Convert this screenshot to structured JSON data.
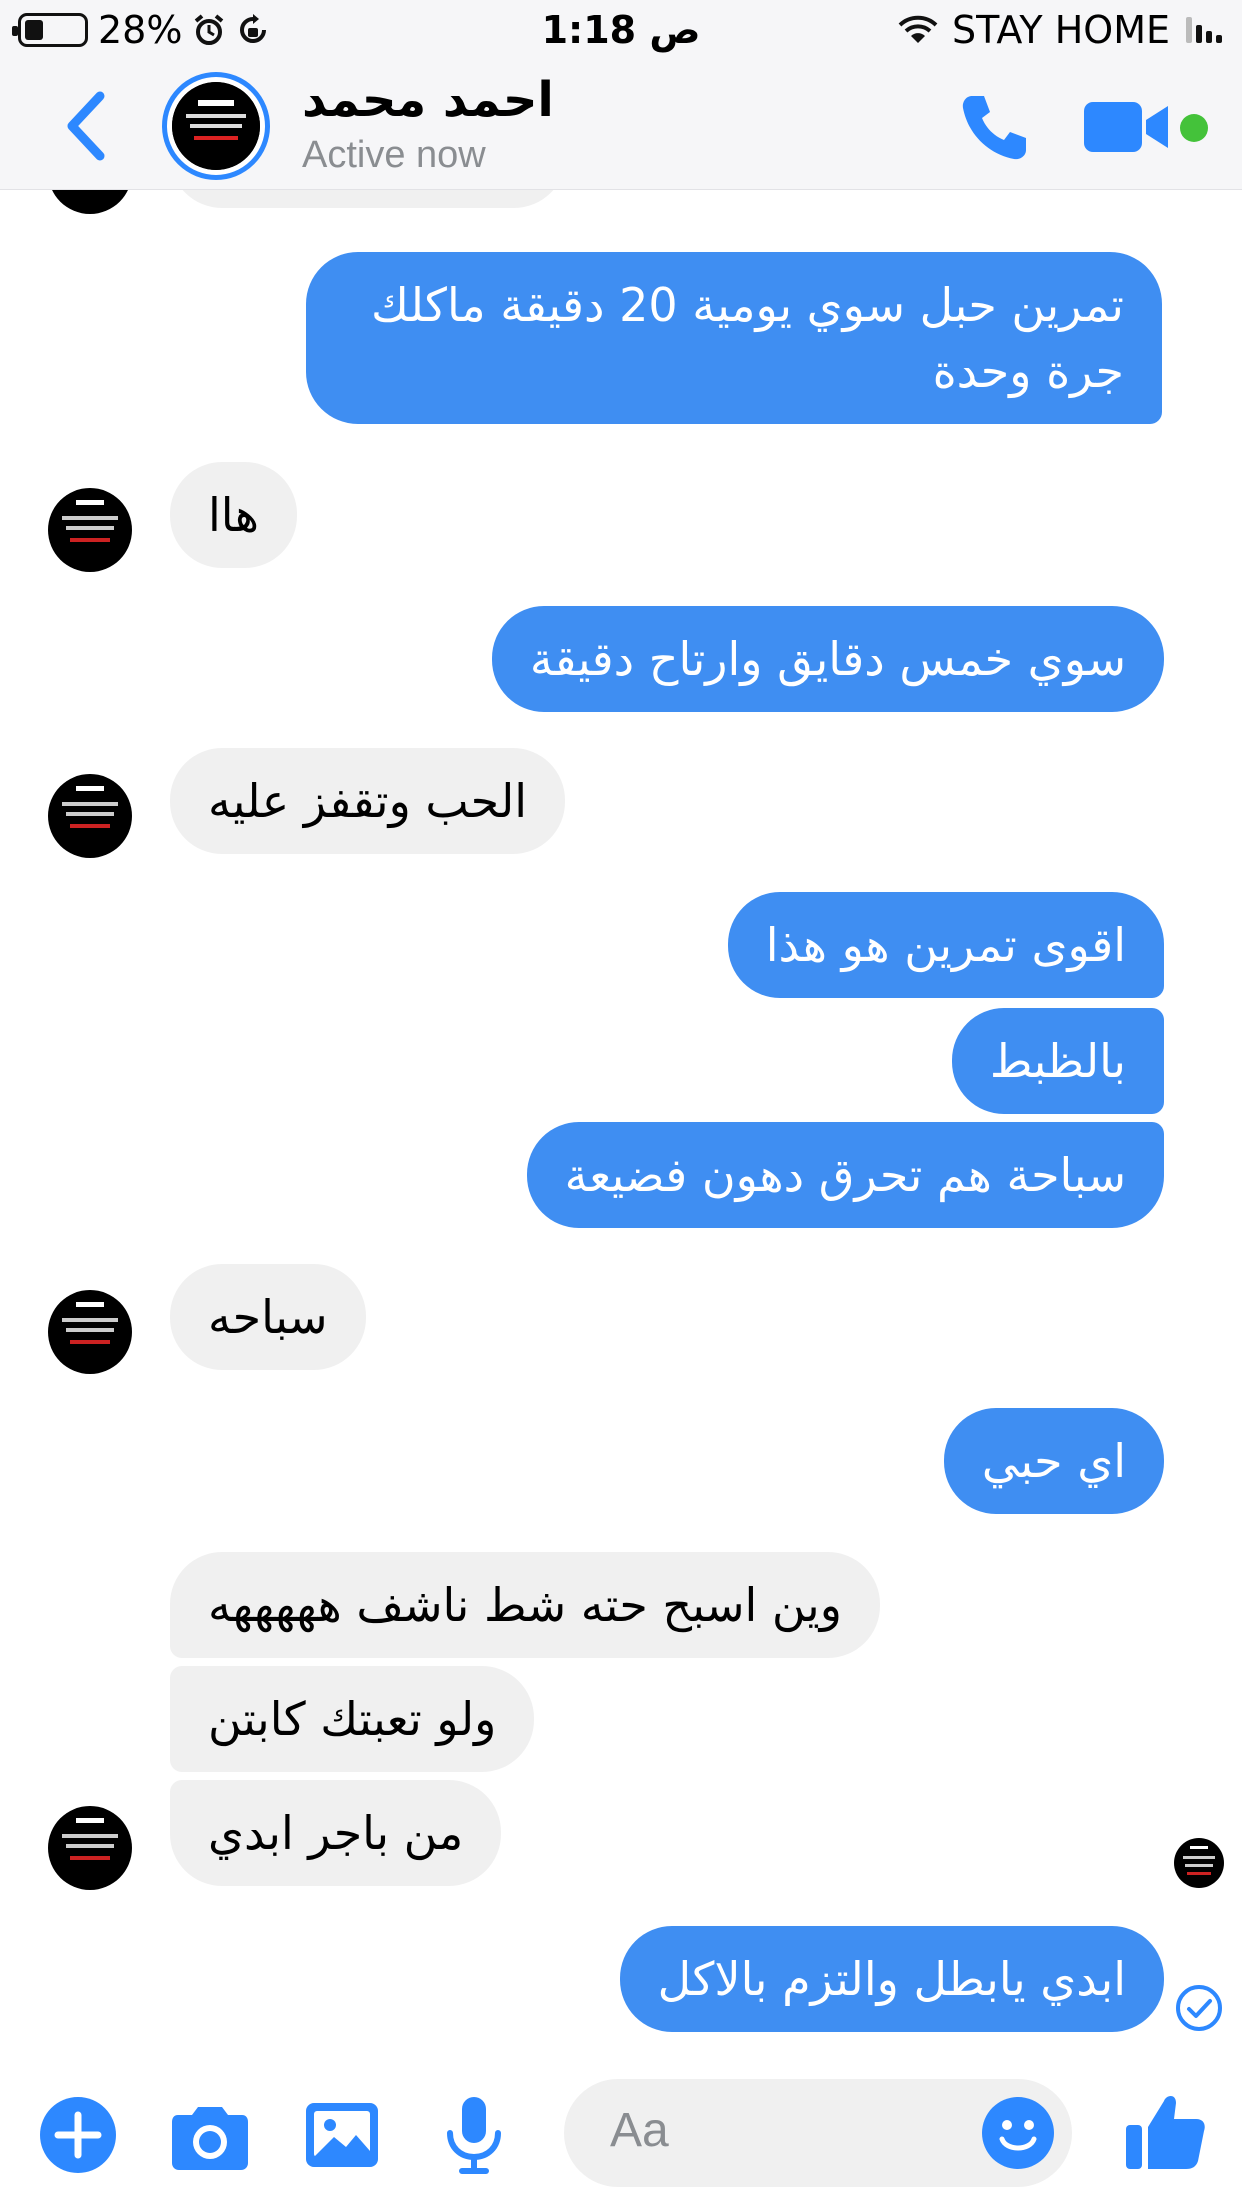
{
  "status_bar": {
    "battery": "28%",
    "time": "1:18 ص",
    "carrier": "STAY HOME"
  },
  "header": {
    "contact_name": "احمد محمد",
    "contact_status": "Active now"
  },
  "messages": [
    {
      "side": "out",
      "text": "تمرين حبل سوي يومية 20 دقيقة ماكلك جرة وحدة"
    },
    {
      "side": "in",
      "text": "هاا"
    },
    {
      "side": "out",
      "text": "سوي خمس دقايق وارتاح دقيقة"
    },
    {
      "side": "in",
      "text": "الحب وتقفز عليه"
    },
    {
      "side": "out",
      "text": "اقوى تمرين هو هذا"
    },
    {
      "side": "out",
      "text": "بالظبط"
    },
    {
      "side": "out",
      "text": "سباحة هم تحرق دهون فضيعة"
    },
    {
      "side": "in",
      "text": "سباحه"
    },
    {
      "side": "out",
      "text": "اي حبي"
    },
    {
      "side": "in",
      "text": "وين اسبح حته شط ناشف هههههه"
    },
    {
      "side": "in",
      "text": "ولو تعبتك كابتن"
    },
    {
      "side": "in",
      "text": "من باجر ابدي"
    },
    {
      "side": "out",
      "text": "ابدي يابطل والتزم بالاكل"
    }
  ],
  "composer": {
    "placeholder": "Aa"
  },
  "colors": {
    "accent": "#2d88ff",
    "outgoing_bubble": "#3f8ef2",
    "incoming_bubble": "#f0f0f0",
    "online": "#44c23a"
  },
  "icons": [
    "back-chevron-icon",
    "phone-icon",
    "video-camera-icon",
    "plus-icon",
    "camera-icon",
    "gallery-icon",
    "microphone-icon",
    "emoji-icon",
    "thumbs-up-icon",
    "sent-check-icon"
  ]
}
